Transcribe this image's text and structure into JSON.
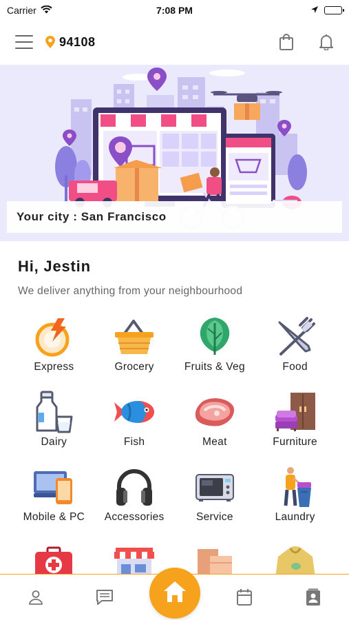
{
  "status_bar": {
    "carrier": "Carrier",
    "time": "7:08 PM"
  },
  "header": {
    "zip_code": "94108"
  },
  "banner": {
    "city_text": "Your city : San Francisco"
  },
  "greeting": {
    "title": "Hi, Jestin",
    "subtitle": "We deliver anything from your neighbourhood"
  },
  "categories": [
    {
      "label": "Express",
      "icon": "express-icon"
    },
    {
      "label": "Grocery",
      "icon": "basket-icon"
    },
    {
      "label": "Fruits & Veg",
      "icon": "lettuce-icon"
    },
    {
      "label": "Food",
      "icon": "fork-knife-icon"
    },
    {
      "label": "Dairy",
      "icon": "milk-bottle-icon"
    },
    {
      "label": "Fish",
      "icon": "fish-icon"
    },
    {
      "label": "Meat",
      "icon": "steak-icon"
    },
    {
      "label": "Furniture",
      "icon": "wardrobe-icon"
    },
    {
      "label": "Mobile & PC",
      "icon": "devices-icon"
    },
    {
      "label": "Accessories",
      "icon": "headphones-icon"
    },
    {
      "label": "Service",
      "icon": "microwave-icon"
    },
    {
      "label": "Laundry",
      "icon": "laundry-icon"
    }
  ],
  "colors": {
    "accent": "#f7a21c",
    "banner_bg": "#ebeafc",
    "text": "#222222",
    "muted": "#666666"
  }
}
